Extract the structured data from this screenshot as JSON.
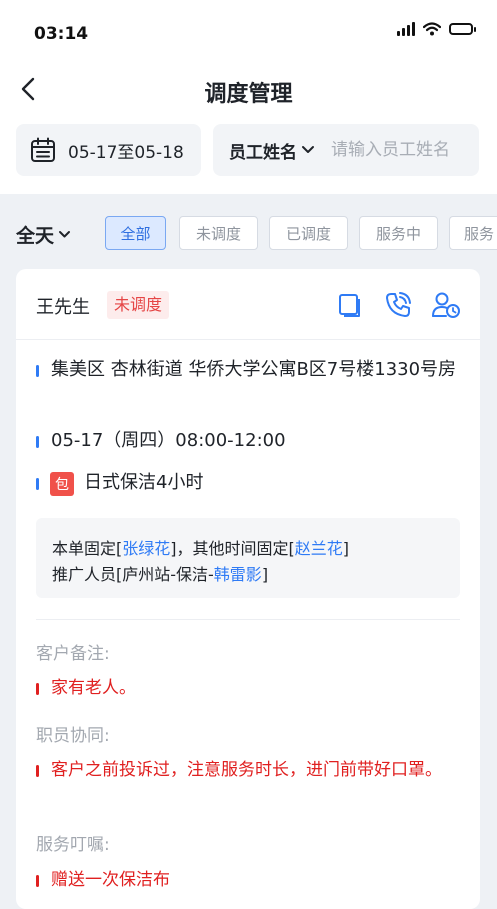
{
  "status_bar": {
    "time": "03:14"
  },
  "nav": {
    "title": "调度管理"
  },
  "filters": {
    "date_range": "05-17至05-18",
    "name_select": "员工姓名",
    "name_placeholder": "请输入员工姓名"
  },
  "tabs": {
    "period": "全天",
    "items": [
      "全部",
      "未调度",
      "已调度",
      "服务中",
      "服务"
    ],
    "active_index": 0
  },
  "order": {
    "customer": "王先生",
    "status": "未调度",
    "address": "集美区 杏林街道 华侨大学公寓B区7号楼1330号房",
    "time": "05-17（周四）08:00-12:00",
    "package_badge": "包",
    "service": "日式保洁4小时",
    "assign": {
      "fixed_prefix": "本单固定[",
      "fixed_name": "张绿花",
      "other_prefix": "]，其他时间固定[",
      "other_name": "赵兰花",
      "other_suffix": "]",
      "promoter_prefix": "推广人员[庐州站-保洁-",
      "promoter_name": "韩雷影",
      "promoter_suffix": "]"
    },
    "customer_note_label": "客户备注:",
    "customer_note": "家有老人。",
    "staff_note_label": "职员协同:",
    "staff_note": "客户之前投诉过，注意服务时长，进门前带好口罩。",
    "service_note_label": "服务叮嘱:",
    "service_note": "赠送一次保洁布"
  },
  "colors": {
    "accent_blue": "#2f7bf5",
    "alert_red": "#e02020",
    "page_bg": "#eef1f5"
  },
  "icons": {
    "back": "chevron-left-icon",
    "calendar": "calendar-icon",
    "dropdown": "chevron-down-icon",
    "copy": "copy-icon",
    "phone": "phone-icon",
    "assign": "user-clock-icon"
  }
}
